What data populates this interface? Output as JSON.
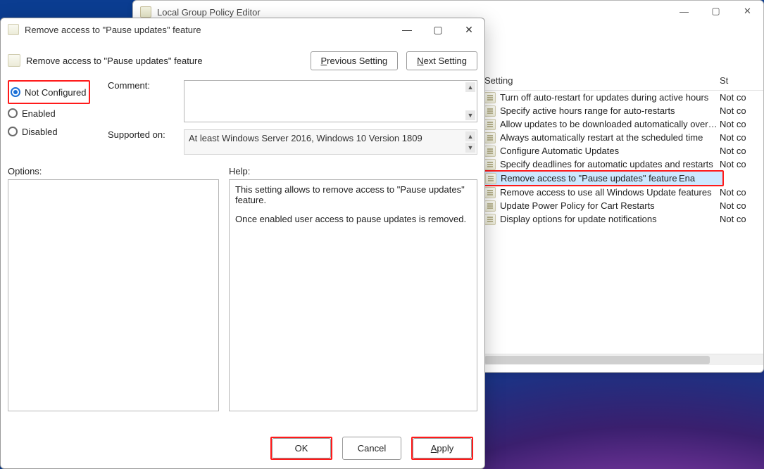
{
  "back_window": {
    "title": "Local Group Policy Editor",
    "columns": {
      "setting": "Setting",
      "state": "St"
    },
    "controls": {
      "min": "—",
      "max": "▢",
      "close": "✕"
    },
    "rows": [
      {
        "name": "Turn off auto-restart for updates during active hours",
        "state": "Not co"
      },
      {
        "name": "Specify active hours range for auto-restarts",
        "state": "Not co"
      },
      {
        "name": "Allow updates to be downloaded automatically over metere...",
        "state": "Not co"
      },
      {
        "name": "Always automatically restart at the scheduled time",
        "state": "Not co"
      },
      {
        "name": "Configure Automatic Updates",
        "state": "Not co"
      },
      {
        "name": "Specify deadlines for automatic updates and restarts",
        "state": "Not co"
      },
      {
        "name": "Remove access to \"Pause updates\" feature",
        "state": "Ena",
        "selected": true,
        "highlighted": true
      },
      {
        "name": "Remove access to use all Windows Update features",
        "state": "Not co"
      },
      {
        "name": "Update Power Policy for Cart Restarts",
        "state": "Not co"
      },
      {
        "name": "Display options for update notifications",
        "state": "Not co"
      }
    ]
  },
  "dialog": {
    "title": "Remove access to \"Pause updates\" feature",
    "policy_title": "Remove access to \"Pause updates\" feature",
    "controls": {
      "min": "—",
      "max": "▢",
      "close": "✕"
    },
    "nav": {
      "prev_label": "Previous Setting",
      "prev_hot": "P",
      "next_label": "Next Setting",
      "next_hot": "N"
    },
    "state_options": {
      "not_configured": "Not Configured",
      "not_configured_hot": "C",
      "enabled": "Enabled",
      "enabled_hot": "E",
      "disabled": "Disabled",
      "disabled_hot": "D",
      "selected": "not_configured"
    },
    "comment_label": "Comment:",
    "comment_value": "",
    "supported_label": "Supported on:",
    "supported_value": "At least Windows Server 2016, Windows 10 Version 1809",
    "options_label": "Options:",
    "help_label": "Help:",
    "help_paragraphs": [
      "This setting allows to remove access to \"Pause updates\" feature.",
      "Once enabled user access to pause updates is removed."
    ],
    "footer": {
      "ok": "OK",
      "cancel": "Cancel",
      "apply": "Apply",
      "apply_hot": "A"
    }
  }
}
